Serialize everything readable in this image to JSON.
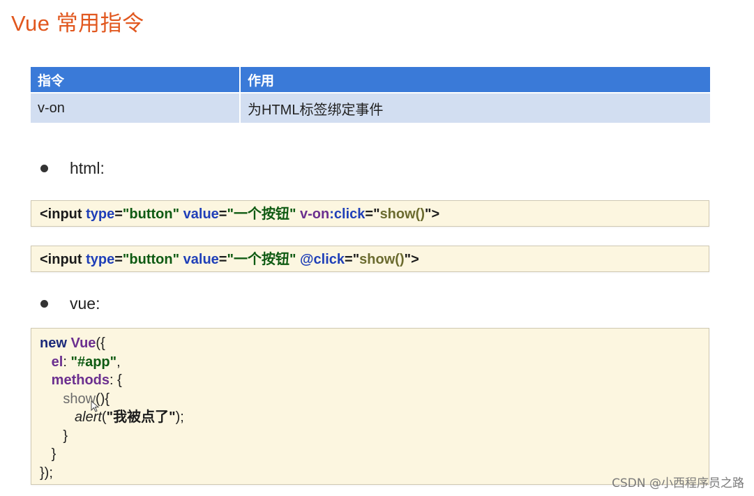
{
  "title": "Vue 常用指令",
  "table": {
    "headers": [
      "指令",
      "作用"
    ],
    "row": {
      "directive": "v-on",
      "description": "为HTML标签绑定事件"
    }
  },
  "sections": {
    "html_label": "html:",
    "vue_label": "vue:"
  },
  "html_code": {
    "line1": {
      "open": "<input",
      "type_attr": "type",
      "eq1": "=",
      "type_val": "\"button\"",
      "value_attr": "value",
      "eq2": "=",
      "value_val": "\"一个按钮\"",
      "directive_prefix": "v-on",
      "directive_event": ":click",
      "eq3": "=",
      "handler_open": "\"",
      "handler": "show()",
      "handler_close": "\"",
      "close": ">"
    },
    "line2": {
      "open": "<input",
      "type_attr": "type",
      "eq1": "=",
      "type_val": "\"button\"",
      "value_attr": "value",
      "eq2": "=",
      "value_val": "\"一个按钮\"",
      "directive": "@click",
      "eq3": "=",
      "handler_open": "\"",
      "handler": "show()",
      "handler_close": "\"",
      "close": ">"
    }
  },
  "vue_code": {
    "l1_kw": "new",
    "l1_class": "Vue",
    "l1_punc": "({",
    "l2_indent": "   ",
    "l2_key": "el",
    "l2_colon": ": ",
    "l2_val": "\"#app\"",
    "l2_comma": ",",
    "l3_indent": "   ",
    "l3_key": "methods",
    "l3_punc": ": {",
    "l4_indent": "      ",
    "l4_method": "show",
    "l4_punc": "(){",
    "l5_indent": "         ",
    "l5_fn": "alert",
    "l5_open": "(",
    "l5_str": "\"我被点了\"",
    "l5_close": ");",
    "l6": "      }",
    "l7": "   }",
    "l8": "});"
  },
  "watermark": "CSDN @小西程序员之路"
}
